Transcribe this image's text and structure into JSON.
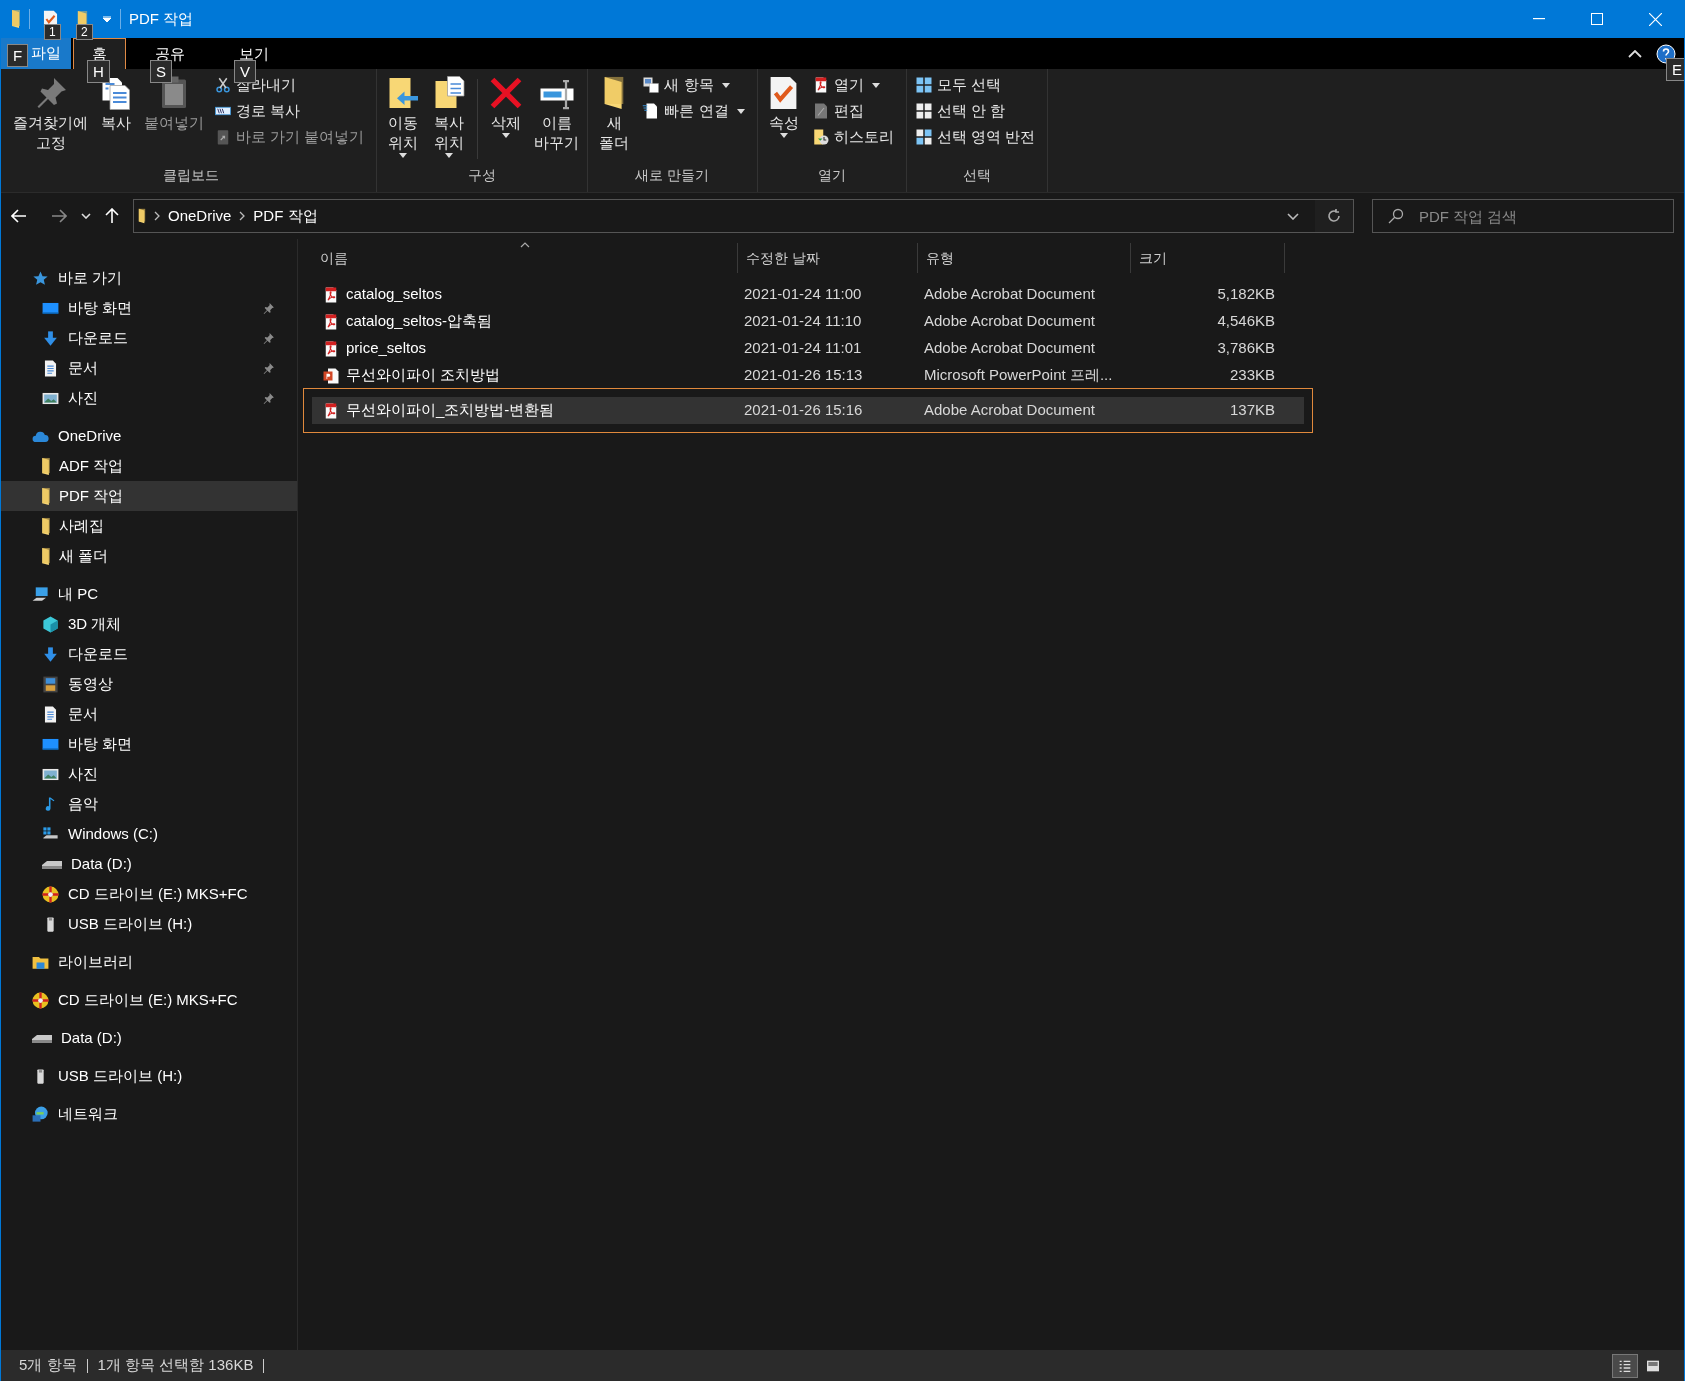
{
  "title_bar": {
    "title": "PDF 작업",
    "quick_access": [
      {
        "kind": "properties",
        "keytip": "1"
      },
      {
        "kind": "new-folder",
        "keytip": "2"
      }
    ]
  },
  "tabs": [
    {
      "label": "파일",
      "keytip": "F",
      "selected": false,
      "kind": "file"
    },
    {
      "label": "홈",
      "keytip": "H",
      "selected": true,
      "kind": "tab"
    },
    {
      "label": "공유",
      "keytip": "S",
      "selected": false,
      "kind": "tab"
    },
    {
      "label": "보기",
      "keytip": "V",
      "selected": false,
      "kind": "tab"
    }
  ],
  "help_keytip": "E",
  "ribbon": {
    "groups": [
      {
        "label": "클립보드",
        "large": [
          {
            "label": "즐겨찾기에\n고정",
            "kind": "pin",
            "dropdown": false,
            "disabled": false
          },
          {
            "label": "복사",
            "kind": "copy",
            "dropdown": false,
            "disabled": false
          },
          {
            "label": "붙여넣기",
            "kind": "paste",
            "dropdown": false,
            "disabled": true
          }
        ],
        "small": [
          {
            "label": "잘라내기",
            "kind": "scissors",
            "dropdown": false,
            "disabled": false
          },
          {
            "label": "경로 복사",
            "kind": "path",
            "dropdown": false,
            "disabled": false
          },
          {
            "label": "바로 가기 붙여넣기",
            "kind": "shortcut",
            "dropdown": false,
            "disabled": true
          }
        ]
      },
      {
        "label": "구성",
        "large": [
          {
            "label": "이동\n위치",
            "kind": "move",
            "dropdown": true,
            "disabled": false
          },
          {
            "label": "복사\n위치",
            "kind": "copyto",
            "dropdown": true,
            "disabled": false
          },
          {
            "label": "삭제",
            "kind": "delete",
            "dropdown": true,
            "disabled": false
          },
          {
            "label": "이름\n바꾸기",
            "kind": "rename",
            "dropdown": false,
            "disabled": false
          }
        ]
      },
      {
        "label": "새로 만들기",
        "large": [
          {
            "label": "새\n폴더",
            "kind": "new-folder",
            "dropdown": false,
            "disabled": false
          }
        ],
        "small": [
          {
            "label": "새 항목",
            "kind": "new-item",
            "dropdown": true,
            "disabled": false
          },
          {
            "label": "빠른 연결",
            "kind": "easy-access",
            "dropdown": true,
            "disabled": false
          }
        ]
      },
      {
        "label": "열기",
        "large": [
          {
            "label": "속성",
            "kind": "properties",
            "dropdown": true,
            "disabled": false
          }
        ],
        "small": [
          {
            "label": "열기",
            "kind": "pdf",
            "dropdown": true,
            "disabled": false
          },
          {
            "label": "편집",
            "kind": "edit",
            "dropdown": false,
            "disabled": false
          },
          {
            "label": "히스토리",
            "kind": "history",
            "dropdown": false,
            "disabled": false
          }
        ]
      },
      {
        "label": "선택",
        "small": [
          {
            "label": "모두 선택",
            "kind": "select-all",
            "dropdown": false,
            "disabled": false
          },
          {
            "label": "선택 안 함",
            "kind": "select-none",
            "dropdown": false,
            "disabled": false
          },
          {
            "label": "선택 영역 반전",
            "kind": "invert",
            "dropdown": false,
            "disabled": false
          }
        ]
      }
    ]
  },
  "address_bar": {
    "path": [
      "OneDrive",
      "PDF 작업"
    ]
  },
  "search": {
    "placeholder": "PDF 작업 검색"
  },
  "sidebar": {
    "items": [
      {
        "label": "바로 가기",
        "kind": "star",
        "selected": false,
        "pinned": false,
        "children": [
          {
            "label": "바탕 화면",
            "kind": "desktop",
            "selected": false,
            "pinned": true
          },
          {
            "label": "다운로드",
            "kind": "download",
            "selected": false,
            "pinned": true
          },
          {
            "label": "문서",
            "kind": "document",
            "selected": false,
            "pinned": true
          },
          {
            "label": "사진",
            "kind": "picture",
            "selected": false,
            "pinned": true
          }
        ]
      },
      {
        "label": "OneDrive",
        "kind": "cloud",
        "selected": false,
        "pinned": false,
        "children": [
          {
            "label": "ADF 작업",
            "kind": "folder",
            "selected": false,
            "pinned": false
          },
          {
            "label": "PDF 작업",
            "kind": "folder",
            "selected": true,
            "pinned": false
          },
          {
            "label": "사례집",
            "kind": "folder",
            "selected": false,
            "pinned": false
          },
          {
            "label": "새 폴더",
            "kind": "folder",
            "selected": false,
            "pinned": false
          }
        ]
      },
      {
        "label": "내 PC",
        "kind": "pc",
        "selected": false,
        "pinned": false,
        "children": [
          {
            "label": "3D 개체",
            "kind": "cube",
            "selected": false,
            "pinned": false
          },
          {
            "label": "다운로드",
            "kind": "download",
            "selected": false,
            "pinned": false
          },
          {
            "label": "동영상",
            "kind": "video",
            "selected": false,
            "pinned": false
          },
          {
            "label": "문서",
            "kind": "document",
            "selected": false,
            "pinned": false
          },
          {
            "label": "바탕 화면",
            "kind": "desktop",
            "selected": false,
            "pinned": false
          },
          {
            "label": "사진",
            "kind": "picture",
            "selected": false,
            "pinned": false
          },
          {
            "label": "음악",
            "kind": "music",
            "selected": false,
            "pinned": false
          },
          {
            "label": "Windows (C:)",
            "kind": "windows-drive",
            "selected": false,
            "pinned": false
          },
          {
            "label": "Data (D:)",
            "kind": "drive",
            "selected": false,
            "pinned": false
          },
          {
            "label": "CD 드라이브 (E:) MKS+FC",
            "kind": "cd",
            "selected": false,
            "pinned": false
          },
          {
            "label": "USB 드라이브 (H:)",
            "kind": "usb",
            "selected": false,
            "pinned": false
          }
        ]
      },
      {
        "label": "라이브러리",
        "kind": "library",
        "selected": false,
        "pinned": false
      },
      {
        "label": "CD 드라이브 (E:) MKS+FC",
        "kind": "cd",
        "selected": false,
        "pinned": false
      },
      {
        "label": "Data (D:)",
        "kind": "drive",
        "selected": false,
        "pinned": false
      },
      {
        "label": "USB 드라이브 (H:)",
        "kind": "usb",
        "selected": false,
        "pinned": false
      },
      {
        "label": "네트워크",
        "kind": "network",
        "selected": false,
        "pinned": false
      }
    ]
  },
  "table": {
    "columns": [
      {
        "label": "이름",
        "sorted": true
      },
      {
        "label": "수정한 날짜",
        "sorted": false
      },
      {
        "label": "유형",
        "sorted": false
      },
      {
        "label": "크기",
        "sorted": false
      }
    ],
    "rows": [
      {
        "name": "catalog_seltos",
        "date": "2021-01-24 11:00",
        "type": "Adobe Acrobat Document",
        "size": "5,182KB",
        "kind": "pdf",
        "selected": false
      },
      {
        "name": "catalog_seltos-압축됨",
        "date": "2021-01-24 11:10",
        "type": "Adobe Acrobat Document",
        "size": "4,546KB",
        "kind": "pdf",
        "selected": false
      },
      {
        "name": "price_seltos",
        "date": "2021-01-24 11:01",
        "type": "Adobe Acrobat Document",
        "size": "3,786KB",
        "kind": "pdf",
        "selected": false
      },
      {
        "name": "무선와이파이 조치방법",
        "date": "2021-01-26 15:13",
        "type": "Microsoft PowerPoint 프레...",
        "size": "233KB",
        "kind": "ppt",
        "selected": false
      },
      {
        "name": "무선와이파이_조치방법-변환됨",
        "date": "2021-01-26 15:16",
        "type": "Adobe Acrobat Document",
        "size": "137KB",
        "kind": "pdf",
        "selected": true
      }
    ]
  },
  "status_bar": {
    "item_count": "5개 항목",
    "selection": "1개 항목 선택함 136KB",
    "views": [
      {
        "kind": "details",
        "selected": true
      },
      {
        "kind": "large-icons",
        "selected": false
      }
    ]
  }
}
